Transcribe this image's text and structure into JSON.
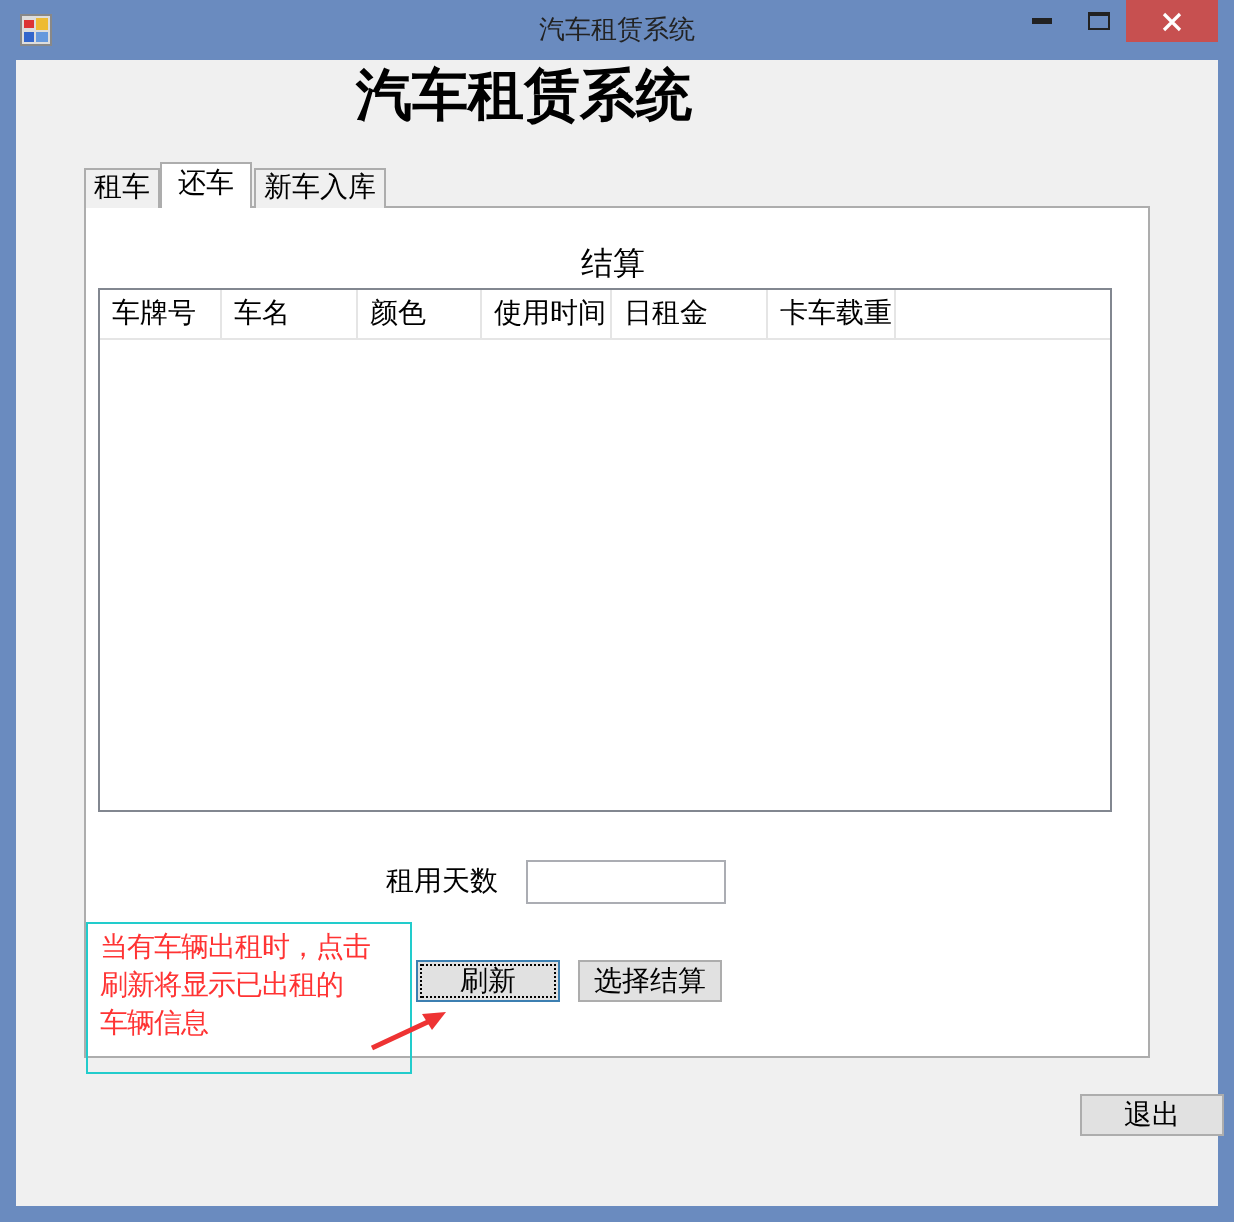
{
  "window": {
    "title": "汽车租赁系统"
  },
  "heading": "汽车租赁系统",
  "tabs": [
    {
      "label": "租车",
      "selected": false
    },
    {
      "label": "还车",
      "selected": true
    },
    {
      "label": "新车入库",
      "selected": false
    }
  ],
  "panel_title": "结算",
  "table": {
    "columns": [
      "车牌号",
      "车名",
      "颜色",
      "使用时间",
      "日租金",
      "卡车载重"
    ]
  },
  "days_field": {
    "label": "租用天数"
  },
  "buttons": [
    {
      "label": "刷新",
      "focused": true
    },
    {
      "label": "选择结算",
      "focused": false
    }
  ],
  "annotation": [
    "当有车辆出租时，点击",
    "刷新将显示已出租的",
    "车辆信息"
  ],
  "exit_button": "退出"
}
